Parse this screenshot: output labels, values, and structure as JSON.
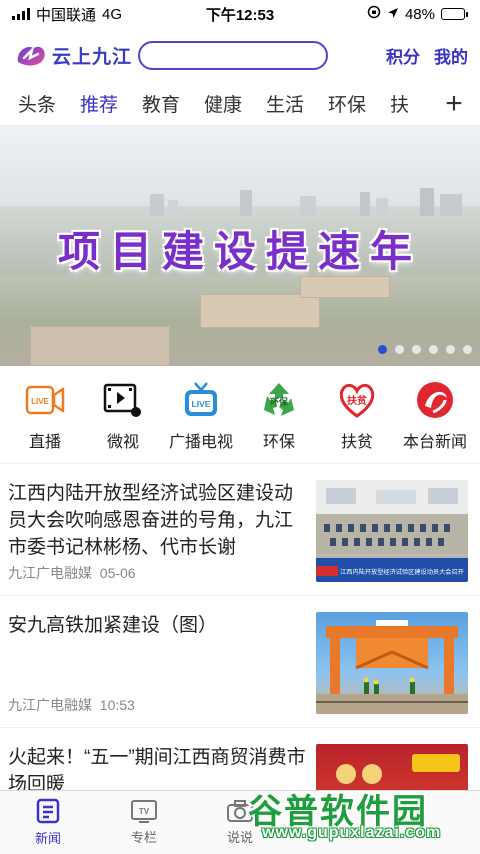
{
  "status": {
    "carrier": "中国联通",
    "network": "4G",
    "time": "下午12:53",
    "battery": "48%",
    "battery_level": 0.48
  },
  "header": {
    "logo_text": "云上九江",
    "search_placeholder": "",
    "points_label": "积分",
    "mine_label": "我的"
  },
  "tabs": [
    {
      "label": "头条",
      "active": false
    },
    {
      "label": "推荐",
      "active": true
    },
    {
      "label": "教育",
      "active": false
    },
    {
      "label": "健康",
      "active": false
    },
    {
      "label": "生活",
      "active": false
    },
    {
      "label": "环保",
      "active": false
    },
    {
      "label": "扶",
      "active": false
    }
  ],
  "tabs_add_icon": "plus-icon",
  "banner": {
    "headline": "项目建设提速年",
    "slide_count": 6,
    "active_slide": 0
  },
  "quick_links": [
    {
      "label": "直播",
      "icon": "live-camera-icon",
      "color": "#f07a1e"
    },
    {
      "label": "微视",
      "icon": "video-film-icon",
      "color": "#111111"
    },
    {
      "label": "广播电视",
      "icon": "tv-live-icon",
      "color": "#2a8fd8"
    },
    {
      "label": "环保",
      "icon": "recycle-icon",
      "color": "#3aa84a"
    },
    {
      "label": "扶贫",
      "icon": "poverty-heart-icon",
      "color": "#e0262e"
    },
    {
      "label": "本台新闻",
      "icon": "station-logo-icon",
      "color": "#e0262e"
    }
  ],
  "icon_text": {
    "live": "LIVE",
    "tv_live": "LIVE",
    "env": "环保",
    "poverty": "扶贫"
  },
  "news": [
    {
      "title": "江西内陆开放型经济试验区建设动员大会吹响感恩奋进的号角，九江市委书记林彬杨、代市长谢",
      "source": "九江广电融媒",
      "time": "05-06",
      "thumb_caption": "江西内陆开放型经济试验区建设动员大会召开"
    },
    {
      "title": "安九高铁加紧建设（图）",
      "source": "九江广电融媒",
      "time": "10:53"
    },
    {
      "title": "火起来！“五一”期间江西商贸消费市场回暖",
      "source": "",
      "time": ""
    }
  ],
  "bottom_nav": [
    {
      "label": "新闻",
      "icon": "news-doc-icon",
      "active": true
    },
    {
      "label": "专栏",
      "icon": "tv-icon",
      "active": false
    },
    {
      "label": "说说",
      "icon": "camera-icon",
      "active": false
    }
  ],
  "watermark": {
    "title": "谷普软件园",
    "url": "www.gupuxlazai.com"
  },
  "colors": {
    "accent": "#3a32c6",
    "banner_text": "#7a2fc8",
    "pager_active": "#2b4fd4"
  }
}
